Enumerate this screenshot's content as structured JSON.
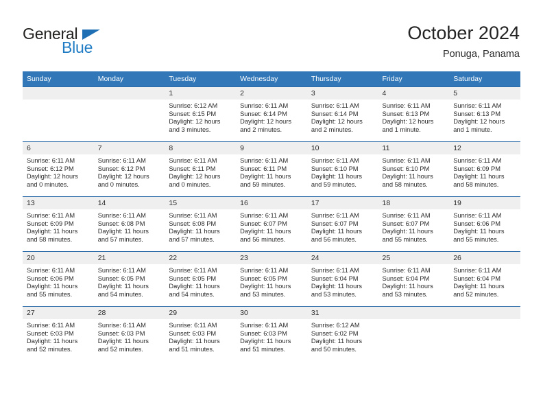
{
  "brand": {
    "name_part1": "General",
    "name_part2": "Blue",
    "accent_color": "#1f7cc4",
    "logo_triangle_color": "#1f6fb5"
  },
  "header": {
    "title": "October 2024",
    "location": "Ponuga, Panama",
    "header_bg_color": "#3278b9",
    "daynum_bg_color": "#efefef",
    "row_divider_color": "#2a6aa8"
  },
  "weekdays": [
    "Sunday",
    "Monday",
    "Tuesday",
    "Wednesday",
    "Thursday",
    "Friday",
    "Saturday"
  ],
  "weeks": [
    [
      {
        "day": "",
        "blank": true
      },
      {
        "day": "",
        "blank": true
      },
      {
        "day": "1",
        "sunrise": "Sunrise: 6:12 AM",
        "sunset": "Sunset: 6:15 PM",
        "daylight_line1": "Daylight: 12 hours",
        "daylight_line2": "and 3 minutes."
      },
      {
        "day": "2",
        "sunrise": "Sunrise: 6:11 AM",
        "sunset": "Sunset: 6:14 PM",
        "daylight_line1": "Daylight: 12 hours",
        "daylight_line2": "and 2 minutes."
      },
      {
        "day": "3",
        "sunrise": "Sunrise: 6:11 AM",
        "sunset": "Sunset: 6:14 PM",
        "daylight_line1": "Daylight: 12 hours",
        "daylight_line2": "and 2 minutes."
      },
      {
        "day": "4",
        "sunrise": "Sunrise: 6:11 AM",
        "sunset": "Sunset: 6:13 PM",
        "daylight_line1": "Daylight: 12 hours",
        "daylight_line2": "and 1 minute."
      },
      {
        "day": "5",
        "sunrise": "Sunrise: 6:11 AM",
        "sunset": "Sunset: 6:13 PM",
        "daylight_line1": "Daylight: 12 hours",
        "daylight_line2": "and 1 minute."
      }
    ],
    [
      {
        "day": "6",
        "sunrise": "Sunrise: 6:11 AM",
        "sunset": "Sunset: 6:12 PM",
        "daylight_line1": "Daylight: 12 hours",
        "daylight_line2": "and 0 minutes."
      },
      {
        "day": "7",
        "sunrise": "Sunrise: 6:11 AM",
        "sunset": "Sunset: 6:12 PM",
        "daylight_line1": "Daylight: 12 hours",
        "daylight_line2": "and 0 minutes."
      },
      {
        "day": "8",
        "sunrise": "Sunrise: 6:11 AM",
        "sunset": "Sunset: 6:11 PM",
        "daylight_line1": "Daylight: 12 hours",
        "daylight_line2": "and 0 minutes."
      },
      {
        "day": "9",
        "sunrise": "Sunrise: 6:11 AM",
        "sunset": "Sunset: 6:11 PM",
        "daylight_line1": "Daylight: 11 hours",
        "daylight_line2": "and 59 minutes."
      },
      {
        "day": "10",
        "sunrise": "Sunrise: 6:11 AM",
        "sunset": "Sunset: 6:10 PM",
        "daylight_line1": "Daylight: 11 hours",
        "daylight_line2": "and 59 minutes."
      },
      {
        "day": "11",
        "sunrise": "Sunrise: 6:11 AM",
        "sunset": "Sunset: 6:10 PM",
        "daylight_line1": "Daylight: 11 hours",
        "daylight_line2": "and 58 minutes."
      },
      {
        "day": "12",
        "sunrise": "Sunrise: 6:11 AM",
        "sunset": "Sunset: 6:09 PM",
        "daylight_line1": "Daylight: 11 hours",
        "daylight_line2": "and 58 minutes."
      }
    ],
    [
      {
        "day": "13",
        "sunrise": "Sunrise: 6:11 AM",
        "sunset": "Sunset: 6:09 PM",
        "daylight_line1": "Daylight: 11 hours",
        "daylight_line2": "and 58 minutes."
      },
      {
        "day": "14",
        "sunrise": "Sunrise: 6:11 AM",
        "sunset": "Sunset: 6:08 PM",
        "daylight_line1": "Daylight: 11 hours",
        "daylight_line2": "and 57 minutes."
      },
      {
        "day": "15",
        "sunrise": "Sunrise: 6:11 AM",
        "sunset": "Sunset: 6:08 PM",
        "daylight_line1": "Daylight: 11 hours",
        "daylight_line2": "and 57 minutes."
      },
      {
        "day": "16",
        "sunrise": "Sunrise: 6:11 AM",
        "sunset": "Sunset: 6:07 PM",
        "daylight_line1": "Daylight: 11 hours",
        "daylight_line2": "and 56 minutes."
      },
      {
        "day": "17",
        "sunrise": "Sunrise: 6:11 AM",
        "sunset": "Sunset: 6:07 PM",
        "daylight_line1": "Daylight: 11 hours",
        "daylight_line2": "and 56 minutes."
      },
      {
        "day": "18",
        "sunrise": "Sunrise: 6:11 AM",
        "sunset": "Sunset: 6:07 PM",
        "daylight_line1": "Daylight: 11 hours",
        "daylight_line2": "and 55 minutes."
      },
      {
        "day": "19",
        "sunrise": "Sunrise: 6:11 AM",
        "sunset": "Sunset: 6:06 PM",
        "daylight_line1": "Daylight: 11 hours",
        "daylight_line2": "and 55 minutes."
      }
    ],
    [
      {
        "day": "20",
        "sunrise": "Sunrise: 6:11 AM",
        "sunset": "Sunset: 6:06 PM",
        "daylight_line1": "Daylight: 11 hours",
        "daylight_line2": "and 55 minutes."
      },
      {
        "day": "21",
        "sunrise": "Sunrise: 6:11 AM",
        "sunset": "Sunset: 6:05 PM",
        "daylight_line1": "Daylight: 11 hours",
        "daylight_line2": "and 54 minutes."
      },
      {
        "day": "22",
        "sunrise": "Sunrise: 6:11 AM",
        "sunset": "Sunset: 6:05 PM",
        "daylight_line1": "Daylight: 11 hours",
        "daylight_line2": "and 54 minutes."
      },
      {
        "day": "23",
        "sunrise": "Sunrise: 6:11 AM",
        "sunset": "Sunset: 6:05 PM",
        "daylight_line1": "Daylight: 11 hours",
        "daylight_line2": "and 53 minutes."
      },
      {
        "day": "24",
        "sunrise": "Sunrise: 6:11 AM",
        "sunset": "Sunset: 6:04 PM",
        "daylight_line1": "Daylight: 11 hours",
        "daylight_line2": "and 53 minutes."
      },
      {
        "day": "25",
        "sunrise": "Sunrise: 6:11 AM",
        "sunset": "Sunset: 6:04 PM",
        "daylight_line1": "Daylight: 11 hours",
        "daylight_line2": "and 53 minutes."
      },
      {
        "day": "26",
        "sunrise": "Sunrise: 6:11 AM",
        "sunset": "Sunset: 6:04 PM",
        "daylight_line1": "Daylight: 11 hours",
        "daylight_line2": "and 52 minutes."
      }
    ],
    [
      {
        "day": "27",
        "sunrise": "Sunrise: 6:11 AM",
        "sunset": "Sunset: 6:03 PM",
        "daylight_line1": "Daylight: 11 hours",
        "daylight_line2": "and 52 minutes."
      },
      {
        "day": "28",
        "sunrise": "Sunrise: 6:11 AM",
        "sunset": "Sunset: 6:03 PM",
        "daylight_line1": "Daylight: 11 hours",
        "daylight_line2": "and 52 minutes."
      },
      {
        "day": "29",
        "sunrise": "Sunrise: 6:11 AM",
        "sunset": "Sunset: 6:03 PM",
        "daylight_line1": "Daylight: 11 hours",
        "daylight_line2": "and 51 minutes."
      },
      {
        "day": "30",
        "sunrise": "Sunrise: 6:11 AM",
        "sunset": "Sunset: 6:03 PM",
        "daylight_line1": "Daylight: 11 hours",
        "daylight_line2": "and 51 minutes."
      },
      {
        "day": "31",
        "sunrise": "Sunrise: 6:12 AM",
        "sunset": "Sunset: 6:02 PM",
        "daylight_line1": "Daylight: 11 hours",
        "daylight_line2": "and 50 minutes."
      },
      {
        "day": "",
        "blank": true
      },
      {
        "day": "",
        "blank": true
      }
    ]
  ]
}
